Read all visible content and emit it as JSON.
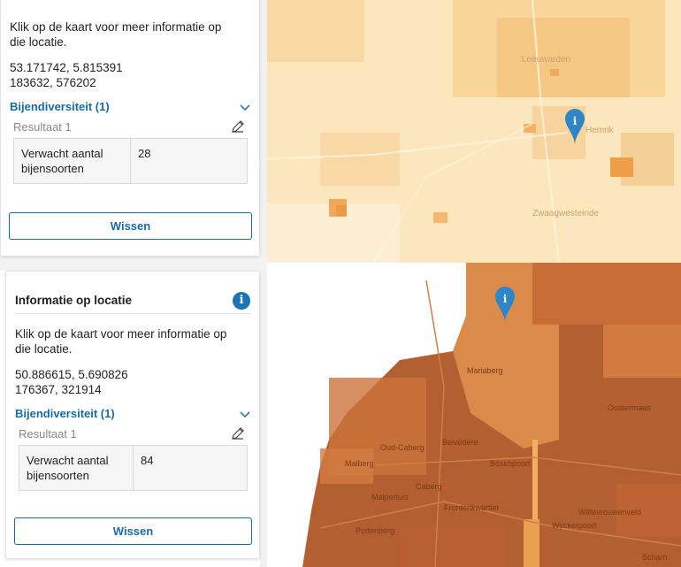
{
  "panel_top": {
    "intro": "Klik op de kaart voor meer informatie op die locatie.",
    "coord_wgs": "53.171742, 5.815391",
    "coord_rd": "183632, 576202",
    "section_title": "Bijendiversiteit (1)",
    "result_label": "Resultaat 1",
    "table_key": "Verwacht aantal bijensoorten",
    "table_value": "28",
    "clear_button": "Wissen"
  },
  "panel_bottom": {
    "title": "Informatie op locatie",
    "info_icon_glyph": "i",
    "intro": "Klik op de kaart voor meer informatie op die locatie.",
    "coord_wgs": "50.886615, 5.690826",
    "coord_rd": "176367, 321914",
    "section_title": "Bijendiversiteit (1)",
    "result_label": "Resultaat 1",
    "table_key": "Verwacht aantal bijensoorten",
    "table_value": "84",
    "clear_button": "Wissen"
  },
  "map_top": {
    "place_labels": [
      "Leeuwarden",
      "Hemrik",
      "Zwaagwesteinde"
    ]
  },
  "map_bottom": {
    "place_labels": [
      "Boschpoort",
      "Belvédère",
      "Oud-Caberg",
      "Caberg",
      "Malberg",
      "Malpertuis",
      "Frontenkwartier",
      "Wyckerpoort",
      "Wittevrouwenveld",
      "Mariaberg",
      "Pottenberg",
      "Oostermaas",
      "Scharn"
    ]
  },
  "colors": {
    "accent": "#1a6aa8",
    "marker": "#2e86c8",
    "map_top_base": "#fbe3b6",
    "map_bottom_base": "#b0562a"
  },
  "icons": [
    "info-icon",
    "chevron-down-icon",
    "pencil-icon",
    "map-marker-icon"
  ]
}
